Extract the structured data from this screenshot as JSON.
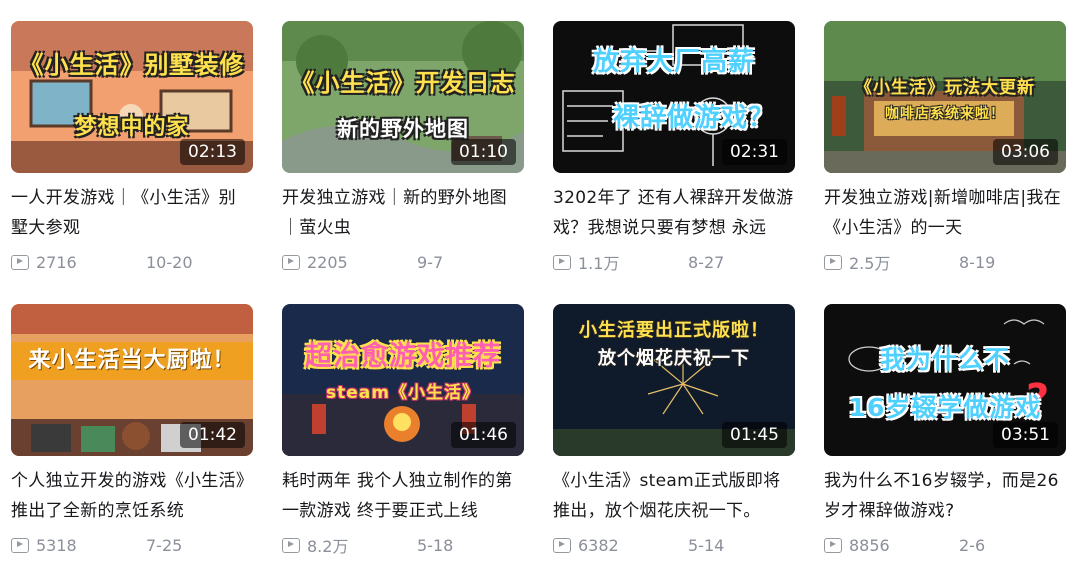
{
  "videos": [
    {
      "overlay_title": "《小生活》别墅装修",
      "overlay_subtitle": "梦想中的家",
      "duration": "02:13",
      "title": "一人开发游戏｜《小生活》别墅大参观",
      "views": "2716",
      "date": "10-20"
    },
    {
      "overlay_title": "《小生活》开发日志",
      "overlay_subtitle": "新的野外地图",
      "duration": "01:10",
      "title": "开发独立游戏｜新的野外地图｜萤火虫",
      "views": "2205",
      "date": "9-7"
    },
    {
      "overlay_title": "放弃大厂高薪",
      "overlay_subtitle": "裸辞做游戏？",
      "duration": "02:31",
      "title": "3202年了 还有人裸辞开发做游戏？我想说只要有梦想 永远",
      "views": "1.1万",
      "date": "8-27"
    },
    {
      "overlay_title": "《小生活》玩法大更新",
      "overlay_subtitle": "咖啡店系统来啦！",
      "duration": "03:06",
      "title": "开发独立游戏|新增咖啡店|我在《小生活》的一天",
      "views": "2.5万",
      "date": "8-19"
    },
    {
      "overlay_title": "来小生活当大厨啦！",
      "overlay_subtitle": "",
      "duration": "01:42",
      "title": "个人独立开发的游戏《小生活》推出了全新的烹饪系统",
      "views": "5318",
      "date": "7-25"
    },
    {
      "overlay_title": "超治愈游戏推荐",
      "overlay_subtitle": "steam《小生活》",
      "duration": "01:46",
      "title": "耗时两年 我个人独立制作的第一款游戏 终于要正式上线",
      "views": "8.2万",
      "date": "5-18"
    },
    {
      "overlay_title": "小生活要出正式版啦！",
      "overlay_subtitle": "放个烟花庆祝一下",
      "duration": "01:45",
      "title": "《小生活》steam正式版即将推出，放个烟花庆祝一下。",
      "views": "6382",
      "date": "5-14"
    },
    {
      "overlay_title": "我为什么不",
      "overlay_subtitle": "16岁辍学做游戏",
      "duration": "03:51",
      "title": "我为什么不16岁辍学，而是26岁才裸辞做游戏?",
      "views": "8856",
      "date": "2-6"
    }
  ],
  "icons": {
    "views": "play-count-icon"
  },
  "colors": {
    "meta_text": "#8a8f99",
    "title_text": "#18191c",
    "overlay_yellow": "#ffe14d"
  }
}
